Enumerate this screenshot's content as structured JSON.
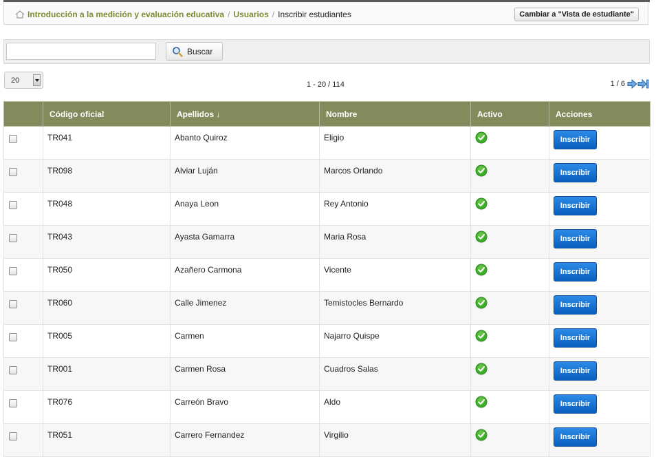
{
  "breadcrumb": {
    "items": [
      "Introducción a la medición y evaluación educativa",
      "Usuarios"
    ],
    "separator": "/",
    "current": "Inscribir estudiantes"
  },
  "student_view_button": "Cambiar a \"Vista de estudiante\"",
  "search": {
    "value": "",
    "button_label": "Buscar"
  },
  "pagination": {
    "per_page": "20",
    "range_text": "1 - 20 / 114",
    "page_text": "1 / 6"
  },
  "table": {
    "columns": [
      "",
      "Código oficial",
      "Apellidos ↓",
      "Nombre",
      "Activo",
      "Acciones"
    ],
    "action_label": "Inscribir",
    "rows": [
      {
        "code": "TR041",
        "lastname": "Abanto Quiroz",
        "firstname": "Eligio"
      },
      {
        "code": "TR098",
        "lastname": "Alviar Luján",
        "firstname": "Marcos Orlando"
      },
      {
        "code": "TR048",
        "lastname": "Anaya Leon",
        "firstname": "Rey Antonio"
      },
      {
        "code": "TR043",
        "lastname": "Ayasta Gamarra",
        "firstname": "Maria Rosa"
      },
      {
        "code": "TR050",
        "lastname": "Azañero Carmona",
        "firstname": "Vicente"
      },
      {
        "code": "TR060",
        "lastname": "Calle Jimenez",
        "firstname": "Temistocles Bernardo"
      },
      {
        "code": "TR005",
        "lastname": "Carmen",
        "firstname": "Najarro Quispe"
      },
      {
        "code": "TR001",
        "lastname": "Carmen Rosa",
        "firstname": "Cuadros Salas"
      },
      {
        "code": "TR076",
        "lastname": "Carreón Bravo",
        "firstname": "Aldo"
      },
      {
        "code": "TR051",
        "lastname": "Carrero Fernandez",
        "firstname": "Virgilio"
      }
    ]
  },
  "colors": {
    "header_bg": "#838b5c",
    "link": "#7e8a32",
    "button_blue": "#0b6fd4",
    "active_green": "#3fae2a"
  },
  "icons": {
    "home": "home-icon",
    "search": "magnifier-icon",
    "next": "arrow-right-icon",
    "last": "arrow-last-icon",
    "active": "check-circle-icon"
  }
}
